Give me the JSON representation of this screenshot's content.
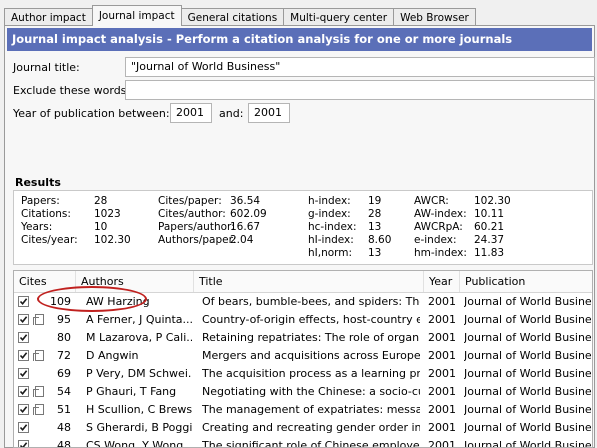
{
  "tabs": [
    "Author impact",
    "Journal impact",
    "General citations",
    "Multi-query center",
    "Web Browser"
  ],
  "active_tab": "Journal impact",
  "banner": "Journal impact analysis - Perform a citation analysis for one or more journals",
  "form": {
    "journal_title_label": "Journal title:",
    "journal_title_value": "\"Journal of World Business\"",
    "exclude_label": "Exclude these words:",
    "exclude_value": "",
    "year_label": "Year of publication between:",
    "year_from": "2001",
    "and_label": "and:",
    "year_to": "2001"
  },
  "results": {
    "title": "Results",
    "stats": [
      [
        [
          "Papers:",
          "28"
        ],
        [
          "Cites/paper:",
          "36.54"
        ],
        [
          "h-index:",
          "19"
        ],
        [
          "AWCR:",
          "102.30"
        ]
      ],
      [
        [
          "Citations:",
          "1023"
        ],
        [
          "Cites/author:",
          "602.09"
        ],
        [
          "g-index:",
          "28"
        ],
        [
          "AW-index:",
          "10.11"
        ]
      ],
      [
        [
          "Years:",
          "10"
        ],
        [
          "Papers/author:",
          "16.67"
        ],
        [
          "hc-index:",
          "13"
        ],
        [
          "AWCRpA:",
          "60.21"
        ]
      ],
      [
        [
          "Cites/year:",
          "102.30"
        ],
        [
          "Authors/paper:",
          "2.04"
        ],
        [
          "hI-index:",
          "8.60"
        ],
        [
          "e-index:",
          "24.37"
        ]
      ],
      [
        [
          "",
          ""
        ],
        [
          "",
          ""
        ],
        [
          "hI,norm:",
          "13"
        ],
        [
          "hm-index:",
          "11.83"
        ]
      ]
    ]
  },
  "table": {
    "headers": [
      "Cites",
      "Authors",
      "Title",
      "Year",
      "Publication"
    ],
    "rows": [
      {
        "cites": "109",
        "authors": "AW Harzing",
        "title": "Of bears, bumble-bees, and spiders: The r...",
        "year": "2001",
        "pub": "Journal of World Business",
        "doc": false
      },
      {
        "cites": "95",
        "authors": "A Ferner, J Quinta...",
        "title": "Country-of-origin effects, host-country ef...",
        "year": "2001",
        "pub": "Journal of World Business",
        "doc": true
      },
      {
        "cites": "80",
        "authors": "M Lazarova, P Cali...",
        "title": "Retaining repatriates: The role of organiza...",
        "year": "2001",
        "pub": "Journal of World Business",
        "doc": false
      },
      {
        "cites": "72",
        "authors": "D Angwin",
        "title": "Mergers and acquisitions across European ...",
        "year": "2001",
        "pub": "Journal of World Business",
        "doc": true
      },
      {
        "cites": "69",
        "authors": "P Very, DM Schwei...",
        "title": "The acquisition process as a learning proce...",
        "year": "2001",
        "pub": "Journal of World Business",
        "doc": false
      },
      {
        "cites": "54",
        "authors": "P Ghauri, T Fang",
        "title": "Negotiating with the Chinese: a socio-cultu...",
        "year": "2001",
        "pub": "Journal of World Business",
        "doc": true
      },
      {
        "cites": "51",
        "authors": "H Scullion, C Brews...",
        "title": "The management of expatriates: message...",
        "year": "2001",
        "pub": "Journal of World Business",
        "doc": true
      },
      {
        "cites": "48",
        "authors": "S Gherardi, B Poggio",
        "title": "Creating and recreating gender order in or...",
        "year": "2001",
        "pub": "Journal of World Business",
        "doc": false
      },
      {
        "cites": "48",
        "authors": "CS Wong, Y Wong,...",
        "title": "The significant role of Chinese employees' ...",
        "year": "2001",
        "pub": "Journal of World Business",
        "doc": false
      }
    ]
  },
  "colors": {
    "banner": "#5b6fb8",
    "highlight_circle": "#c0211f"
  }
}
